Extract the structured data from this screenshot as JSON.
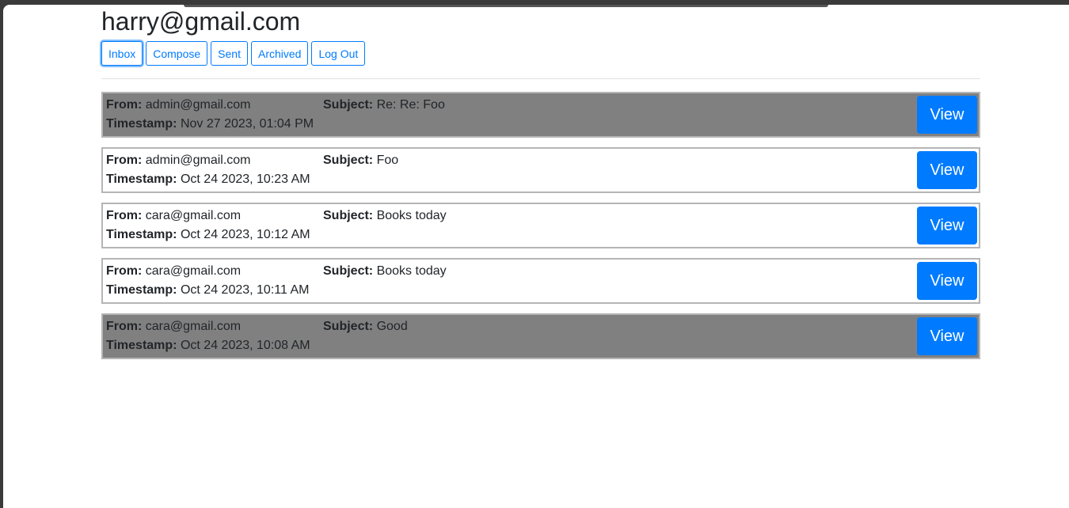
{
  "user": {
    "email": "harry@gmail.com"
  },
  "nav": {
    "inbox": "Inbox",
    "compose": "Compose",
    "sent": "Sent",
    "archived": "Archived",
    "logout": "Log Out"
  },
  "labels": {
    "from": "From:",
    "timestamp": "Timestamp:",
    "subject": "Subject:",
    "view": "View"
  },
  "emails": [
    {
      "from": "admin@gmail.com",
      "subject": "Re: Re: Foo",
      "timestamp": "Nov 27 2023, 01:04 PM",
      "read": true
    },
    {
      "from": "admin@gmail.com",
      "subject": "Foo",
      "timestamp": "Oct 24 2023, 10:23 AM",
      "read": false
    },
    {
      "from": "cara@gmail.com",
      "subject": "Books today",
      "timestamp": "Oct 24 2023, 10:12 AM",
      "read": false
    },
    {
      "from": "cara@gmail.com",
      "subject": "Books today",
      "timestamp": "Oct 24 2023, 10:11 AM",
      "read": false
    },
    {
      "from": "cara@gmail.com",
      "subject": "Good",
      "timestamp": "Oct 24 2023, 10:08 AM",
      "read": true
    }
  ],
  "colors": {
    "primary": "#007bff",
    "read_row": "#808080",
    "unread_row": "#ffffff"
  }
}
